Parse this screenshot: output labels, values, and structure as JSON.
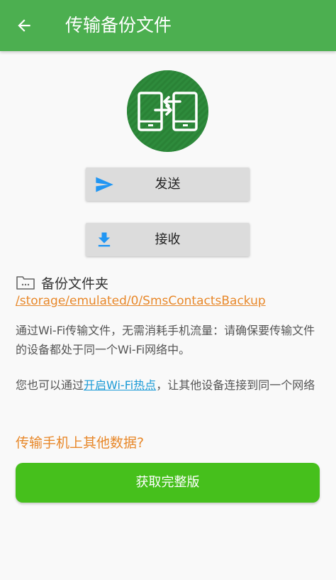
{
  "appbar": {
    "title": "传输备份文件",
    "back_icon": "arrow-back-icon",
    "background": "#4caf50"
  },
  "hero": {
    "icon": "phone-transfer-icon",
    "background": "#2e8b3c"
  },
  "actions": {
    "send_label": "发送",
    "send_icon": "send-icon",
    "receive_label": "接收",
    "receive_icon": "download-icon",
    "icon_color": "#2196f3"
  },
  "folder": {
    "icon": "folder-icon",
    "title": "备份文件夹",
    "path": "/storage/emulated/0/SmsContactsBackup"
  },
  "info": {
    "para1": "通过Wi-Fi传输文件，无需消耗手机流量：请确保要传输文件的设备都处于同一个Wi-Fi网络中。",
    "para2_prefix": "您也可以通过",
    "para2_link": "开启Wi-Fi热点",
    "para2_suffix": "，让其他设备连接到同一个网络"
  },
  "promo": {
    "heading": "传输手机上其他数据?",
    "button_label": "获取完整版",
    "accent": "#e8882a",
    "button_color": "#46c01c"
  }
}
